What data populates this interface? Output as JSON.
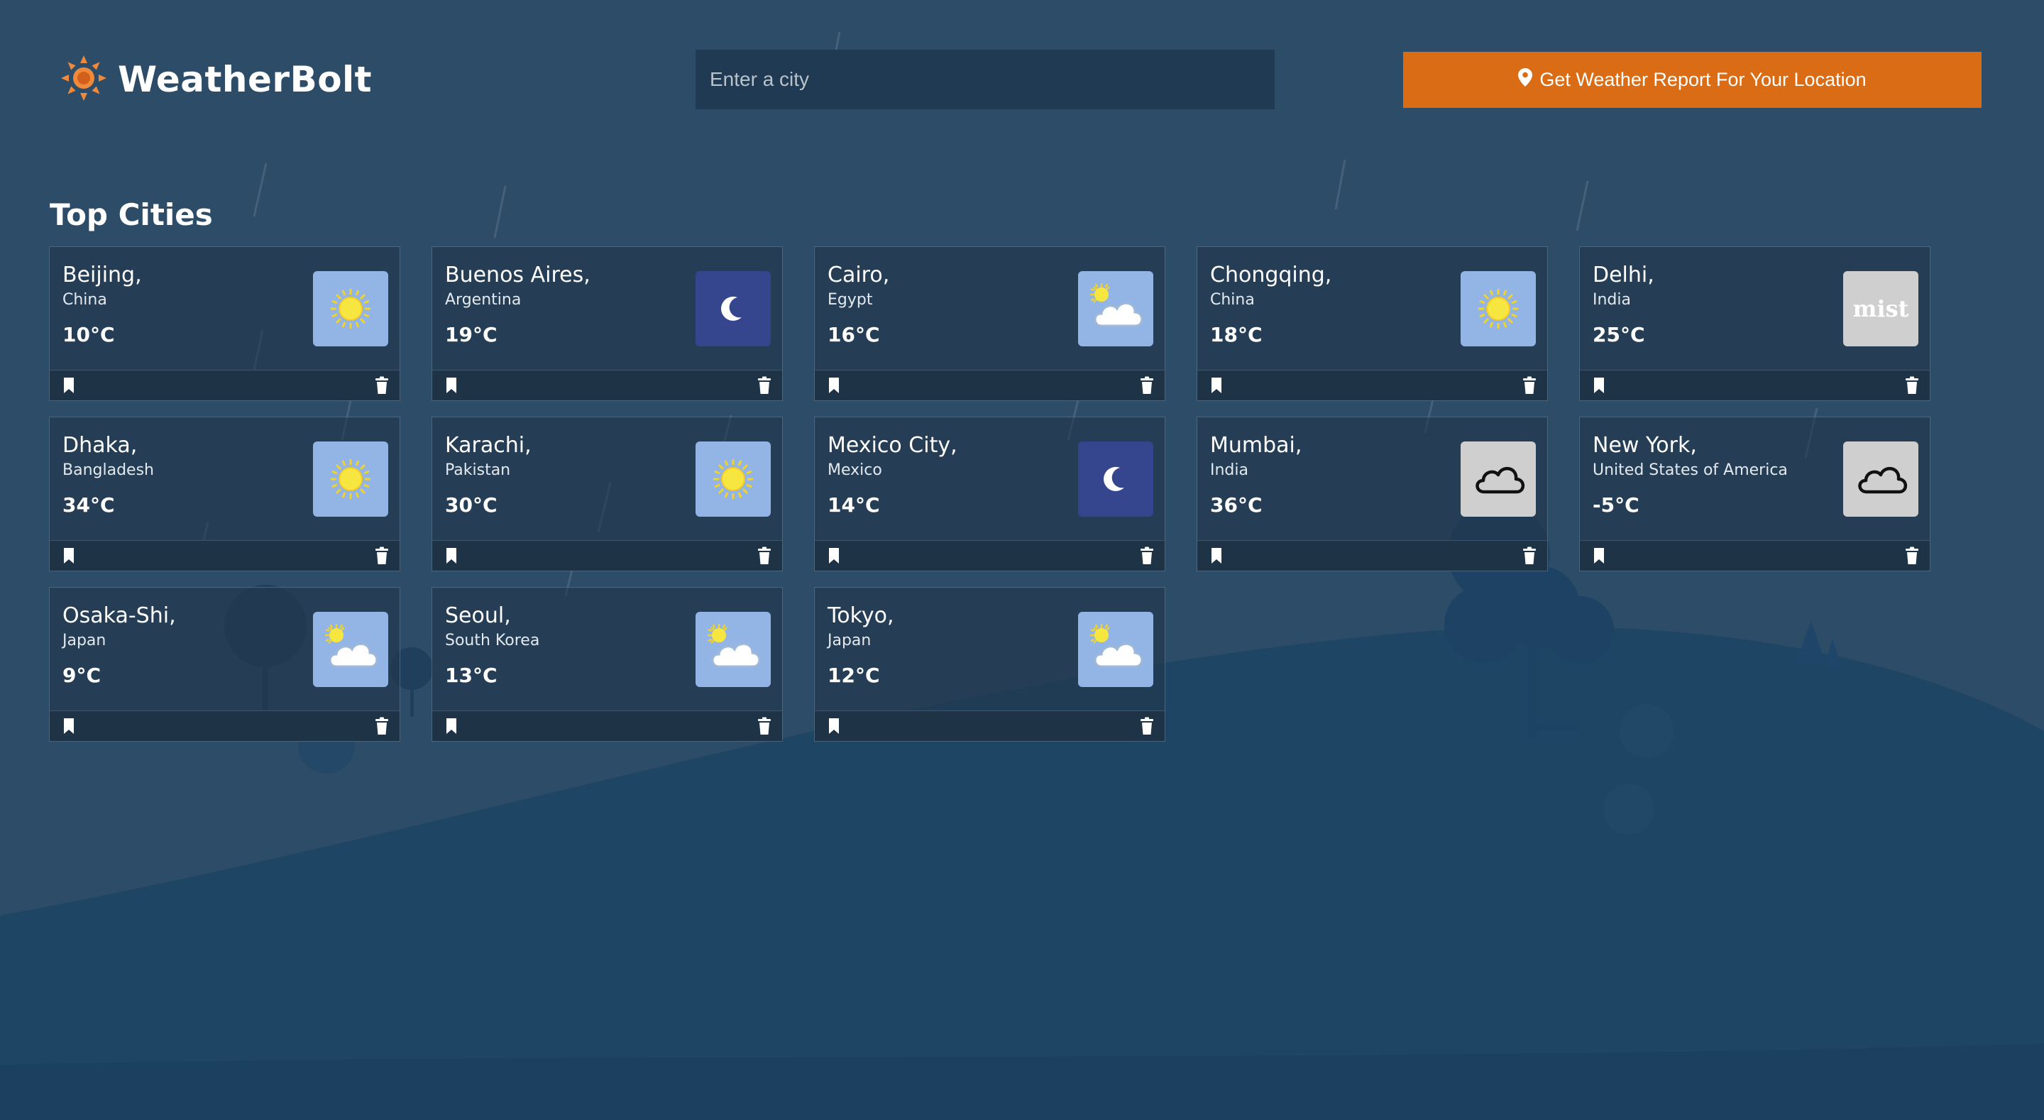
{
  "header": {
    "app_name": "WeatherBolt",
    "logo_icon": "sun-icon",
    "search_placeholder": "Enter a city",
    "search_value": "",
    "location_button_label": "Get Weather Report For Your Location",
    "location_button_icon": "map-marker-icon"
  },
  "section_title": "Top Cities",
  "colors": {
    "background": "#2b4b67",
    "accent": "#d96c14",
    "card_bg": "#22364a",
    "sunny_tile": "#92b5e6",
    "night_tile": "#36468e",
    "cloud_tile": "#cfcfcf"
  },
  "cities": [
    {
      "city": "Beijing,",
      "country": "China",
      "temp": "10°C",
      "icon": "sunny"
    },
    {
      "city": "Buenos Aires,",
      "country": "Argentina",
      "temp": "19°C",
      "icon": "clear-night"
    },
    {
      "city": "Cairo,",
      "country": "Egypt",
      "temp": "16°C",
      "icon": "partly-cloudy"
    },
    {
      "city": "Chongqing,",
      "country": "China",
      "temp": "18°C",
      "icon": "sunny"
    },
    {
      "city": "Delhi,",
      "country": "India",
      "temp": "25°C",
      "icon": "mist",
      "icon_text": "mist"
    },
    {
      "city": "Dhaka,",
      "country": "Bangladesh",
      "temp": "34°C",
      "icon": "sunny"
    },
    {
      "city": "Karachi,",
      "country": "Pakistan",
      "temp": "30°C",
      "icon": "sunny"
    },
    {
      "city": "Mexico City,",
      "country": "Mexico",
      "temp": "14°C",
      "icon": "clear-night"
    },
    {
      "city": "Mumbai,",
      "country": "India",
      "temp": "36°C",
      "icon": "cloud"
    },
    {
      "city": "New York,",
      "country": "United States of America",
      "temp": "-5°C",
      "icon": "cloud"
    },
    {
      "city": "Osaka-Shi,",
      "country": "Japan",
      "temp": "9°C",
      "icon": "partly-cloudy"
    },
    {
      "city": "Seoul,",
      "country": "South Korea",
      "temp": "13°C",
      "icon": "partly-cloudy"
    },
    {
      "city": "Tokyo,",
      "country": "Japan",
      "temp": "12°C",
      "icon": "partly-cloudy"
    }
  ]
}
